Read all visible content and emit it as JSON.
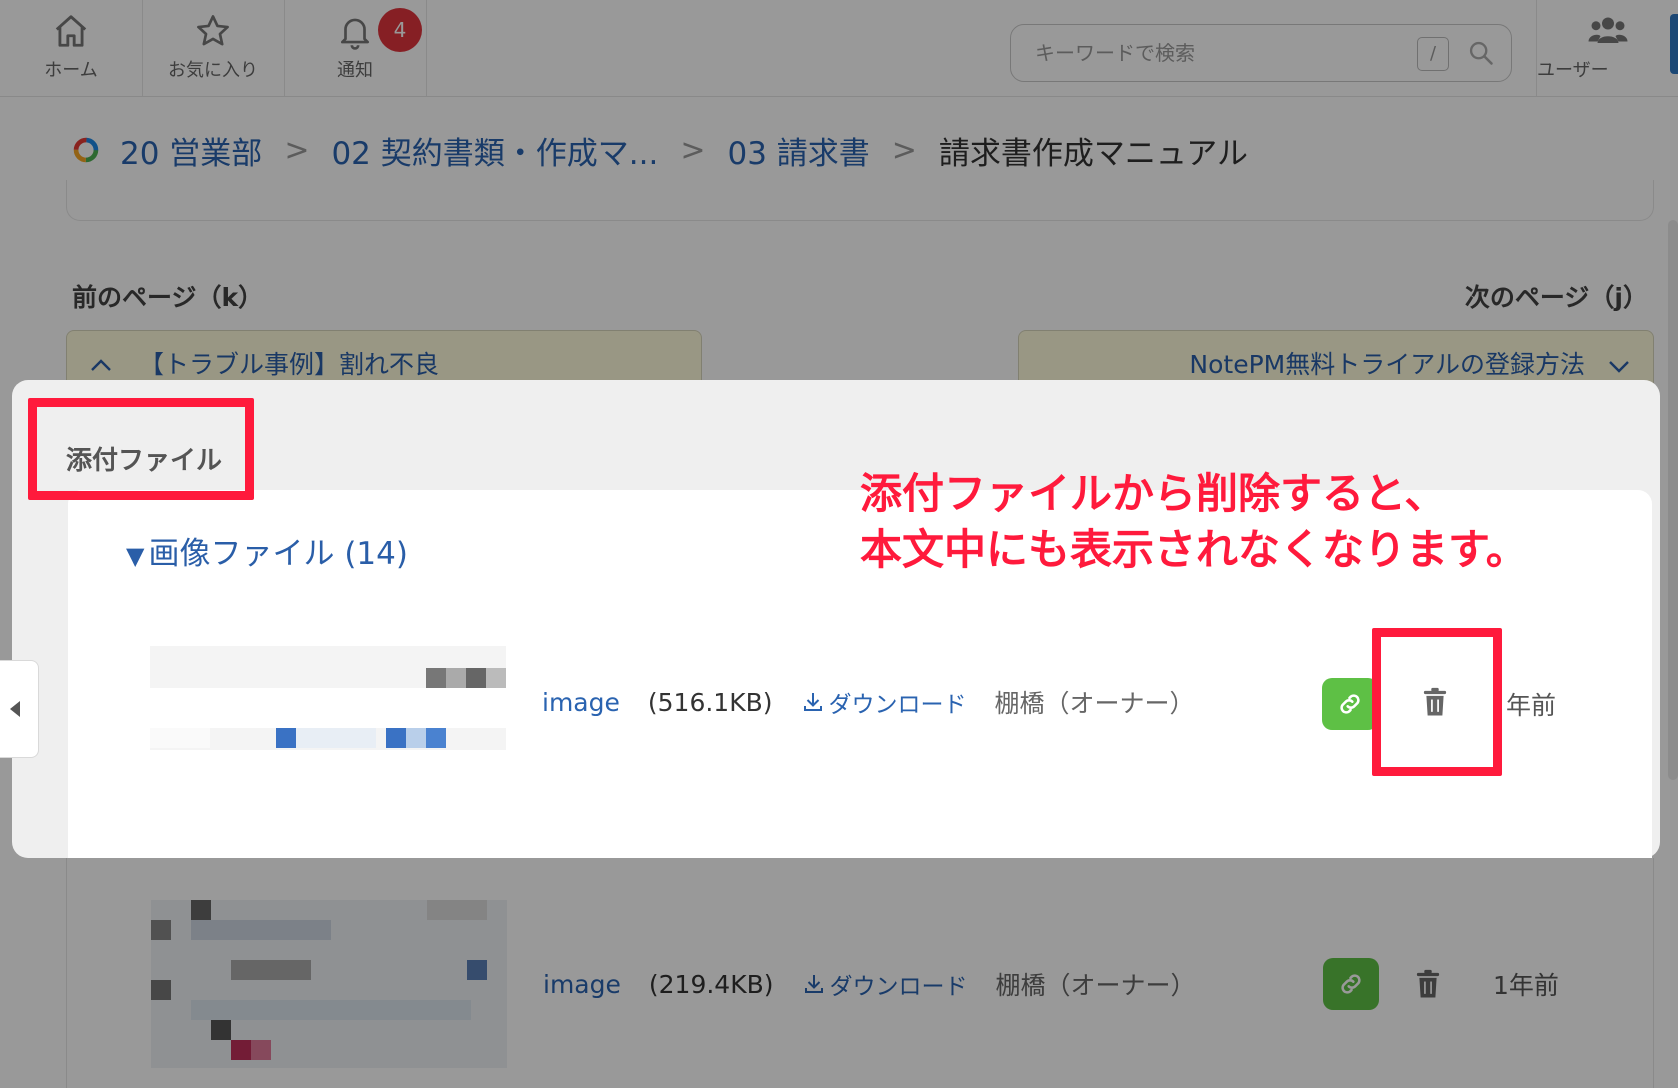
{
  "nav": {
    "home_label": "ホーム",
    "favorites_label": "お気に入り",
    "notifications_label": "通知",
    "notification_count": "4",
    "users_label": "ユーザー",
    "search_placeholder": "キーワードで検索",
    "search_shortcut": "/"
  },
  "breadcrumb": {
    "items": [
      "20 営業部",
      "02 契約書類・作成マ...",
      "03 請求書"
    ],
    "current": "請求書作成マニュアル",
    "separator": ">"
  },
  "pager": {
    "prev_label": "前のページ（k）",
    "next_label": "次のページ（j）",
    "prev_title": "【トラブル事例】割れ不良",
    "next_title": "NotePM無料トライアルの登録方法"
  },
  "attachments": {
    "title": "添付ファイル",
    "section_marker": "▼",
    "section_label": "画像ファイル (14)",
    "files": [
      {
        "name": "image",
        "size": "(516.1KB)",
        "download_label": "ダウンロード",
        "owner": "棚橋（オーナー）",
        "ago": "年前"
      },
      {
        "name": "image",
        "size": "(219.4KB)",
        "download_label": "ダウンロード",
        "owner": "棚橋（オーナー）",
        "ago": "1年前"
      }
    ]
  },
  "annotation": {
    "line1": "添付ファイルから削除すると、",
    "line2": "本文中にも表示されなくなります。",
    "color": "#ff1a3c"
  },
  "colors": {
    "link": "#2a63b0",
    "link_button": "#5ec045",
    "badge": "#e0343c",
    "pager_bg": "#fffcdc"
  }
}
